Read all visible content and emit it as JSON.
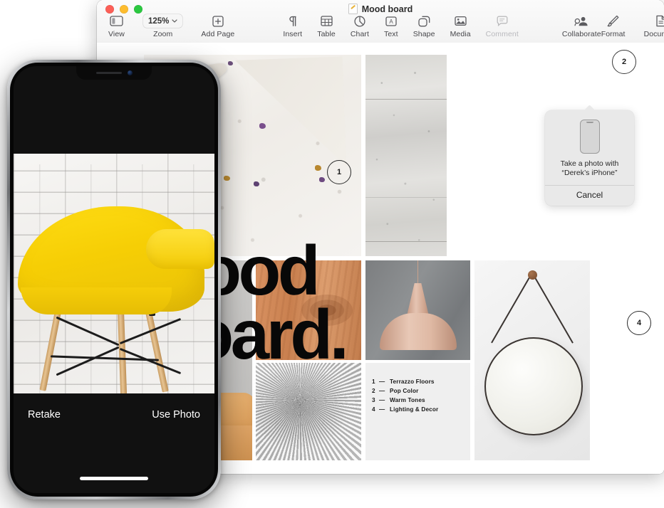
{
  "window": {
    "title": "Mood board",
    "doc_icon": "keynote-document-icon",
    "traffic_lights": [
      {
        "name": "close",
        "color": "#fc5f57"
      },
      {
        "name": "minimize",
        "color": "#fdbc2e"
      },
      {
        "name": "zoom",
        "color": "#2bc840"
      }
    ]
  },
  "toolbar": {
    "left": [
      {
        "label": "View",
        "icon": "sidebar-icon"
      },
      {
        "label": "Zoom",
        "icon": "chevron-down-icon",
        "value": "125%"
      },
      {
        "label": "Add Page",
        "icon": "plus-square-icon"
      }
    ],
    "center": [
      {
        "label": "Insert",
        "icon": "pilcrow-icon"
      },
      {
        "label": "Table",
        "icon": "table-icon"
      },
      {
        "label": "Chart",
        "icon": "pie-chart-icon"
      },
      {
        "label": "Text",
        "icon": "text-box-icon"
      },
      {
        "label": "Shape",
        "icon": "shape-icon"
      },
      {
        "label": "Media",
        "icon": "photo-icon"
      },
      {
        "label": "Comment",
        "icon": "comment-bubble-icon",
        "disabled": true
      },
      {
        "label": "Collaborate",
        "icon": "collaborate-person-icon"
      }
    ],
    "right": [
      {
        "label": "Format",
        "icon": "paintbrush-icon"
      },
      {
        "label": "Document",
        "icon": "document-icon"
      }
    ]
  },
  "popover": {
    "phone_icon": "iphone-icon",
    "message_line1": "Take a photo with",
    "message_line2": "“Derek’s iPhone”",
    "cancel_label": "Cancel"
  },
  "document": {
    "headline_line1": "Mood",
    "headline_line2": "Board.",
    "annotations": [
      {
        "number": "1",
        "target": "terrazzo-image"
      },
      {
        "number": "2",
        "target": "empty-placeholder-area"
      },
      {
        "number": "4",
        "target": "pendant-lamp-image"
      }
    ],
    "list_items": [
      {
        "num": "1",
        "dash": "—",
        "text": "Terrazzo Floors"
      },
      {
        "num": "2",
        "dash": "—",
        "text": "Pop Color"
      },
      {
        "num": "3",
        "dash": "—",
        "text": "Warm Tones"
      },
      {
        "num": "4",
        "dash": "—",
        "text": "Lighting & Decor"
      }
    ],
    "images": [
      {
        "name": "terrazzo-texture"
      },
      {
        "name": "concrete-wall-texture"
      },
      {
        "name": "tan-leather-sofa"
      },
      {
        "name": "wood-grain-texture"
      },
      {
        "name": "grey-fur-rug"
      },
      {
        "name": "copper-pendant-lamp"
      },
      {
        "name": "round-hanging-mirror"
      }
    ]
  },
  "iphone": {
    "photo_subject": "yellow-eames-chair-on-white-brick-wall",
    "retake_label": "Retake",
    "use_photo_label": "Use Photo"
  }
}
